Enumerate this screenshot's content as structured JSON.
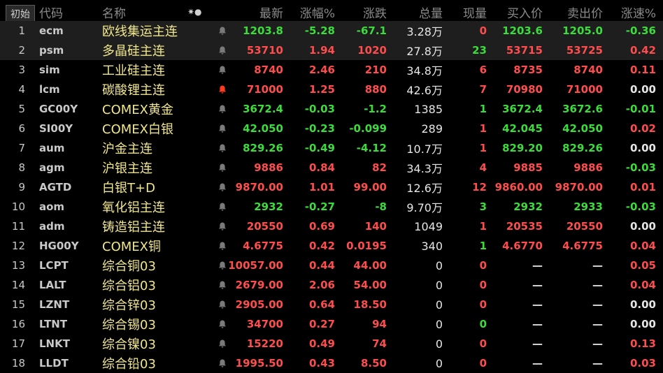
{
  "header": {
    "init_button": "初始",
    "col_code": "代码",
    "col_name": "名称",
    "col_sort": "✷●",
    "col_latest": "最新",
    "col_pct": "涨幅%",
    "col_change": "涨跌",
    "col_volume": "总量",
    "col_current": "现量",
    "col_bid": "买入价",
    "col_ask": "卖出价",
    "col_speed": "涨速%"
  },
  "colors": {
    "up": "#ff4d4d",
    "down": "#3ddc3d",
    "name": "#f0e68c",
    "alert_active": "#ff3b1f"
  },
  "rows": [
    {
      "idx": "1",
      "code": "ecm",
      "name": "欧线集运主连",
      "bell": "inactive",
      "latest": "1203.8",
      "pct": "-5.28",
      "chg": "-67.1",
      "vol": "3.28万",
      "cur": "0",
      "bid": "1203.6",
      "ask": "1205.0",
      "speed": "-0.36",
      "lc": "down",
      "pc": "down",
      "cc": "down",
      "curc": "up",
      "bc": "down",
      "ac": "down",
      "sc": "down"
    },
    {
      "idx": "2",
      "code": "psm",
      "name": "多晶硅主连",
      "bell": "inactive",
      "latest": "53710",
      "pct": "1.94",
      "chg": "1020",
      "vol": "27.8万",
      "cur": "23",
      "bid": "53715",
      "ask": "53725",
      "speed": "0.42",
      "lc": "up",
      "pc": "up",
      "cc": "up",
      "curc": "down",
      "bc": "up",
      "ac": "up",
      "sc": "up"
    },
    {
      "idx": "3",
      "code": "sim",
      "name": "工业硅主连",
      "bell": "inactive",
      "latest": "8740",
      "pct": "2.46",
      "chg": "210",
      "vol": "34.8万",
      "cur": "6",
      "bid": "8735",
      "ask": "8740",
      "speed": "0.11",
      "lc": "up",
      "pc": "up",
      "cc": "up",
      "curc": "up",
      "bc": "up",
      "ac": "up",
      "sc": "up"
    },
    {
      "idx": "4",
      "code": "lcm",
      "name": "碳酸锂主连",
      "bell": "active",
      "latest": "71000",
      "pct": "1.25",
      "chg": "880",
      "vol": "42.6万",
      "cur": "7",
      "bid": "70980",
      "ask": "71000",
      "speed": "0.00",
      "lc": "up",
      "pc": "up",
      "cc": "up",
      "curc": "up",
      "bc": "up",
      "ac": "up",
      "sc": "flat"
    },
    {
      "idx": "5",
      "code": "GC00Y",
      "name": "COMEX黄金",
      "bell": "inactive",
      "latest": "3672.4",
      "pct": "-0.03",
      "chg": "-1.2",
      "vol": "1385",
      "cur": "1",
      "bid": "3672.4",
      "ask": "3672.6",
      "speed": "-0.01",
      "lc": "down",
      "pc": "down",
      "cc": "down",
      "curc": "down",
      "bc": "down",
      "ac": "down",
      "sc": "down"
    },
    {
      "idx": "6",
      "code": "SI00Y",
      "name": "COMEX白银",
      "bell": "inactive",
      "latest": "42.050",
      "pct": "-0.23",
      "chg": "-0.099",
      "vol": "289",
      "cur": "1",
      "bid": "42.045",
      "ask": "42.050",
      "speed": "0.02",
      "lc": "down",
      "pc": "down",
      "cc": "down",
      "curc": "up",
      "bc": "down",
      "ac": "down",
      "sc": "up"
    },
    {
      "idx": "7",
      "code": "aum",
      "name": "沪金主连",
      "bell": "inactive",
      "latest": "829.26",
      "pct": "-0.49",
      "chg": "-4.12",
      "vol": "10.7万",
      "cur": "1",
      "bid": "829.20",
      "ask": "829.26",
      "speed": "0.00",
      "lc": "down",
      "pc": "down",
      "cc": "down",
      "curc": "up",
      "bc": "down",
      "ac": "down",
      "sc": "flat"
    },
    {
      "idx": "8",
      "code": "agm",
      "name": "沪银主连",
      "bell": "inactive",
      "latest": "9886",
      "pct": "0.84",
      "chg": "82",
      "vol": "34.3万",
      "cur": "4",
      "bid": "9885",
      "ask": "9886",
      "speed": "-0.03",
      "lc": "up",
      "pc": "up",
      "cc": "up",
      "curc": "up",
      "bc": "up",
      "ac": "up",
      "sc": "down"
    },
    {
      "idx": "9",
      "code": "AGTD",
      "name": "白银T+D",
      "bell": "inactive",
      "latest": "9870.00",
      "pct": "1.01",
      "chg": "99.00",
      "vol": "12.6万",
      "cur": "12",
      "bid": "9860.00",
      "ask": "9870.00",
      "speed": "0.01",
      "lc": "up",
      "pc": "up",
      "cc": "up",
      "curc": "up",
      "bc": "up",
      "ac": "up",
      "sc": "up"
    },
    {
      "idx": "10",
      "code": "aom",
      "name": "氧化铝主连",
      "bell": "inactive",
      "latest": "2932",
      "pct": "-0.27",
      "chg": "-8",
      "vol": "9.70万",
      "cur": "3",
      "bid": "2932",
      "ask": "2933",
      "speed": "-0.03",
      "lc": "down",
      "pc": "down",
      "cc": "down",
      "curc": "down",
      "bc": "down",
      "ac": "down",
      "sc": "down"
    },
    {
      "idx": "11",
      "code": "adm",
      "name": "铸造铝主连",
      "bell": "inactive",
      "latest": "20550",
      "pct": "0.69",
      "chg": "140",
      "vol": "1049",
      "cur": "1",
      "bid": "20535",
      "ask": "20550",
      "speed": "0.00",
      "lc": "up",
      "pc": "up",
      "cc": "up",
      "curc": "up",
      "bc": "up",
      "ac": "up",
      "sc": "flat"
    },
    {
      "idx": "12",
      "code": "HG00Y",
      "name": "COMEX铜",
      "bell": "inactive",
      "latest": "4.6775",
      "pct": "0.42",
      "chg": "0.0195",
      "vol": "340",
      "cur": "1",
      "bid": "4.6770",
      "ask": "4.6775",
      "speed": "0.04",
      "lc": "up",
      "pc": "up",
      "cc": "up",
      "curc": "down",
      "bc": "up",
      "ac": "up",
      "sc": "up"
    },
    {
      "idx": "13",
      "code": "LCPT",
      "name": "综合铜03",
      "bell": "inactive",
      "latest": "10057.00",
      "pct": "0.44",
      "chg": "44.00",
      "vol": "0",
      "cur": "0",
      "bid": "—",
      "ask": "—",
      "speed": "0.05",
      "lc": "up",
      "pc": "up",
      "cc": "up",
      "curc": "up",
      "bc": "dash",
      "ac": "dash",
      "sc": "up"
    },
    {
      "idx": "14",
      "code": "LALT",
      "name": "综合铝03",
      "bell": "inactive",
      "latest": "2679.00",
      "pct": "2.06",
      "chg": "54.00",
      "vol": "0",
      "cur": "0",
      "bid": "—",
      "ask": "—",
      "speed": "0.04",
      "lc": "up",
      "pc": "up",
      "cc": "up",
      "curc": "up",
      "bc": "dash",
      "ac": "dash",
      "sc": "up"
    },
    {
      "idx": "15",
      "code": "LZNT",
      "name": "综合锌03",
      "bell": "inactive",
      "latest": "2905.00",
      "pct": "0.64",
      "chg": "18.50",
      "vol": "0",
      "cur": "0",
      "bid": "—",
      "ask": "—",
      "speed": "0.00",
      "lc": "up",
      "pc": "up",
      "cc": "up",
      "curc": "up",
      "bc": "dash",
      "ac": "dash",
      "sc": "flat"
    },
    {
      "idx": "16",
      "code": "LTNT",
      "name": "综合锡03",
      "bell": "inactive",
      "latest": "34700",
      "pct": "0.27",
      "chg": "94",
      "vol": "0",
      "cur": "0",
      "bid": "—",
      "ask": "—",
      "speed": "0.00",
      "lc": "up",
      "pc": "up",
      "cc": "up",
      "curc": "down",
      "bc": "dash",
      "ac": "dash",
      "sc": "flat"
    },
    {
      "idx": "17",
      "code": "LNKT",
      "name": "综合镍03",
      "bell": "inactive",
      "latest": "15220",
      "pct": "0.49",
      "chg": "74",
      "vol": "0",
      "cur": "0",
      "bid": "—",
      "ask": "—",
      "speed": "0.13",
      "lc": "up",
      "pc": "up",
      "cc": "up",
      "curc": "up",
      "bc": "dash",
      "ac": "dash",
      "sc": "up"
    },
    {
      "idx": "18",
      "code": "LLDT",
      "name": "综合铅03",
      "bell": "inactive",
      "latest": "1995.50",
      "pct": "0.43",
      "chg": "8.50",
      "vol": "0",
      "cur": "0",
      "bid": "—",
      "ask": "—",
      "speed": "0.03",
      "lc": "up",
      "pc": "up",
      "cc": "up",
      "curc": "up",
      "bc": "dash",
      "ac": "dash",
      "sc": "up"
    }
  ]
}
